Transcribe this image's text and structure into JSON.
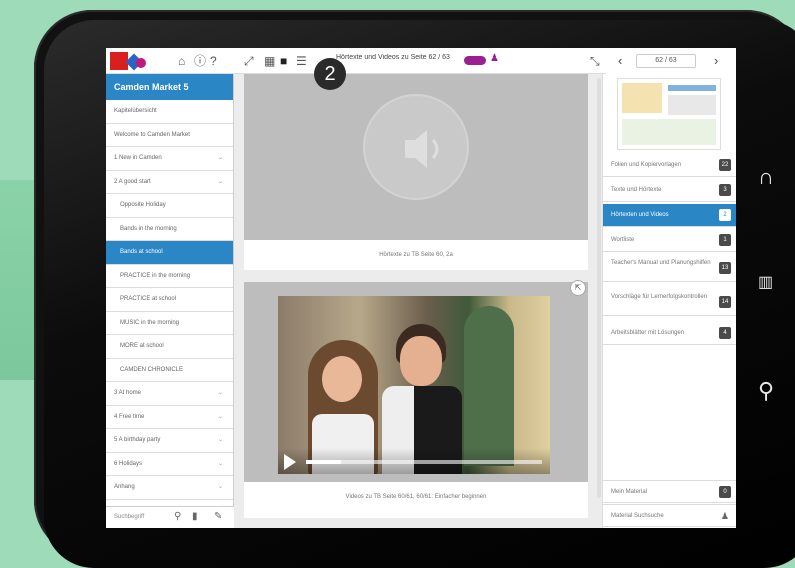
{
  "header": {
    "breadcrumb": "Hörtexte und Videos zu Seite 62 / 63",
    "page_indicator": "62 / 63",
    "highlight_badge": "2"
  },
  "sidebar": {
    "title": "Camden Market 5",
    "items": [
      {
        "label": "Kapitelübersicht",
        "sub": false,
        "chevron": false,
        "active": false
      },
      {
        "label": "Welcome to Camden Market",
        "sub": false,
        "chevron": false,
        "active": false
      },
      {
        "label": "1 New in Camden",
        "sub": false,
        "chevron": true,
        "active": false
      },
      {
        "label": "2 A good start",
        "sub": false,
        "chevron": true,
        "active": false
      },
      {
        "label": "Opposite Holiday",
        "sub": true,
        "chevron": false,
        "active": false
      },
      {
        "label": "Bands in the morning",
        "sub": true,
        "chevron": false,
        "active": false
      },
      {
        "label": "Bands at school",
        "sub": true,
        "chevron": false,
        "active": true
      },
      {
        "label": "PRACTICE in the morning",
        "sub": true,
        "chevron": false,
        "active": false
      },
      {
        "label": "PRACTICE at school",
        "sub": true,
        "chevron": false,
        "active": false
      },
      {
        "label": "MUSIC in the morning",
        "sub": true,
        "chevron": false,
        "active": false
      },
      {
        "label": "MORE at school",
        "sub": true,
        "chevron": false,
        "active": false
      },
      {
        "label": "CAMDEN CHRONICLE",
        "sub": true,
        "chevron": false,
        "active": false
      },
      {
        "label": "3 At home",
        "sub": false,
        "chevron": true,
        "active": false
      },
      {
        "label": "4 Free time",
        "sub": false,
        "chevron": true,
        "active": false
      },
      {
        "label": "5 A birthday party",
        "sub": false,
        "chevron": true,
        "active": false
      },
      {
        "label": "6 Holidays",
        "sub": false,
        "chevron": true,
        "active": false
      },
      {
        "label": "Anhang",
        "sub": false,
        "chevron": true,
        "active": false
      }
    ],
    "search_placeholder": "Suchbegriff"
  },
  "main": {
    "audio_caption": "Hörtexte zu TB Seite 60, 2a",
    "video_caption": "Videos zu TB Seite 60/61, 60/61: Einfacher beginnen",
    "video_progress": 0.15
  },
  "right": {
    "items": [
      {
        "label": "Folien und Kopiervorlagen",
        "count": "22",
        "active": false,
        "tall": false
      },
      {
        "label": "Texte und Hörtexte",
        "count": "3",
        "active": false,
        "tall": false
      },
      {
        "label": "Hörtexten und Videos",
        "count": "2",
        "active": true,
        "tall": false
      },
      {
        "label": "Wortliste",
        "count": "1",
        "active": false,
        "tall": false
      },
      {
        "label": "Teacher's Manual und Planungshilfen",
        "count": "13",
        "active": false,
        "tall": true
      },
      {
        "label": "Vorschläge für Lernerfolgskontrollen",
        "count": "14",
        "active": false,
        "tall": true
      },
      {
        "label": "Arbeitsblätter mit Lösungen",
        "count": "4",
        "active": false,
        "tall": false
      }
    ],
    "bottom_items": [
      {
        "label": "Mein Material",
        "count": "0"
      },
      {
        "label": "Material Suchsuche",
        "count": ""
      }
    ]
  }
}
